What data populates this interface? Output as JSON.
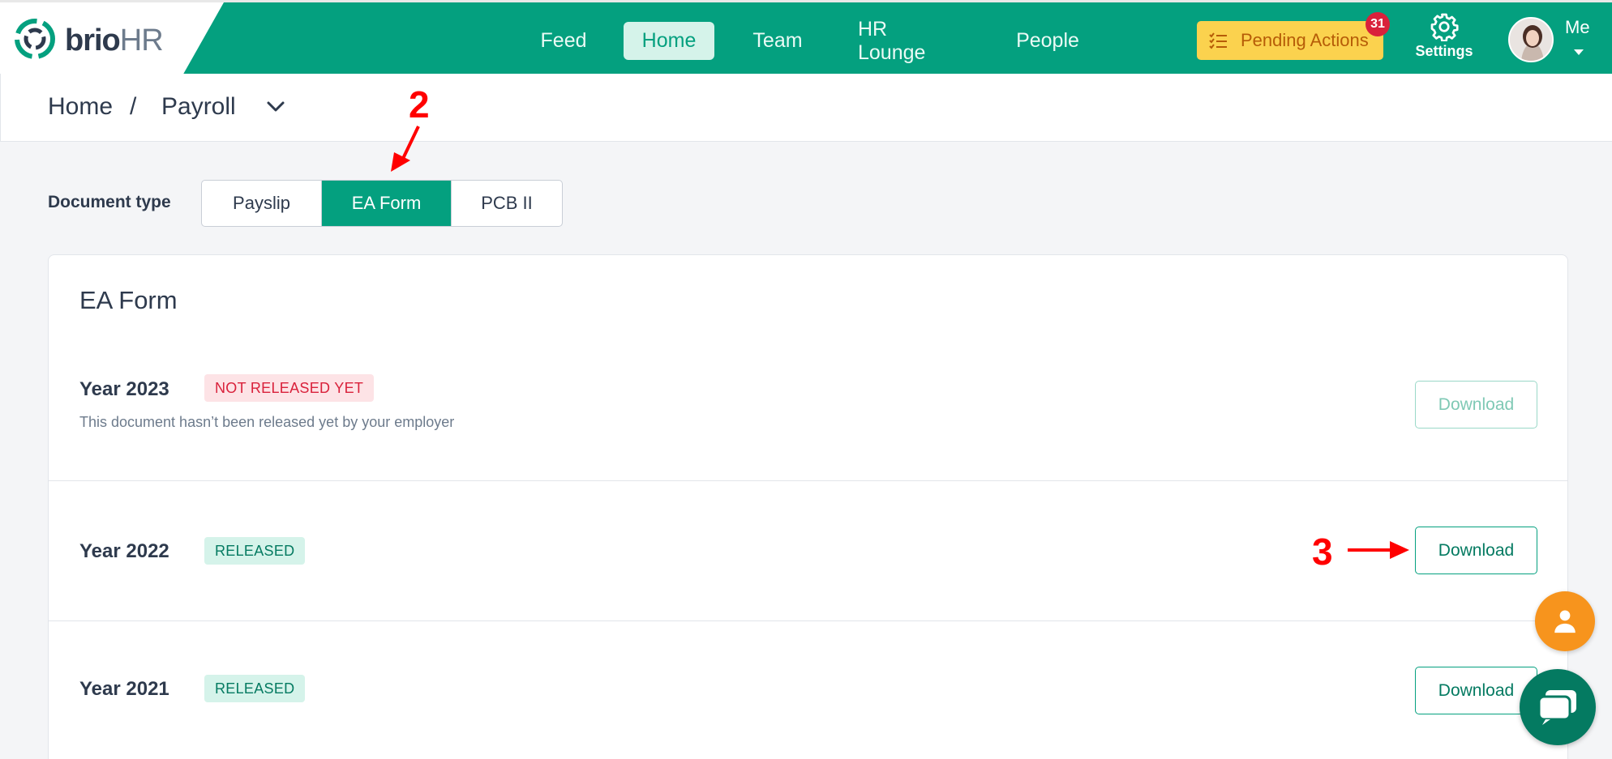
{
  "header": {
    "logo_brand": "brio",
    "logo_suffix": "HR",
    "nav": [
      {
        "label": "Feed"
      },
      {
        "label": "Home"
      },
      {
        "label": "Team"
      },
      {
        "label": "HR Lounge"
      },
      {
        "label": "People"
      }
    ],
    "active_nav": "Home",
    "pending_label": "Pending Actions",
    "pending_count": "31",
    "settings_label": "Settings",
    "me_label": "Me"
  },
  "breadcrumb": {
    "home": "Home",
    "separator": "/",
    "current": "Payroll"
  },
  "document_type": {
    "label": "Document type",
    "options": [
      "Payslip",
      "EA Form",
      "PCB II"
    ],
    "selected": "EA Form"
  },
  "card": {
    "title": "EA Form",
    "rows": [
      {
        "year": "Year 2023",
        "status": "NOT RELEASED YET",
        "note": "This document hasn’t been released yet by your employer",
        "action": "Download"
      },
      {
        "year": "Year 2022",
        "status": "RELEASED",
        "action": "Download"
      },
      {
        "year": "Year 2021",
        "status": "RELEASED",
        "action": "Download"
      }
    ]
  },
  "annotations": {
    "step2": "2",
    "step3": "3",
    "color": "#ff0000"
  },
  "colors": {
    "brand_green": "#04a07f",
    "pending_yellow": "#fbd24e",
    "badge_red": "#d9213b",
    "fab_orange": "#f7941d"
  }
}
